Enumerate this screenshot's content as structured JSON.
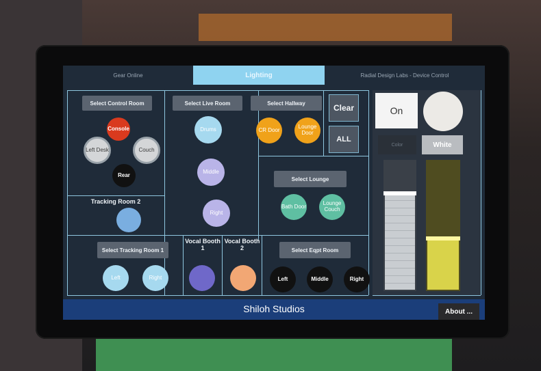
{
  "tabs": [
    {
      "label": "Gear Online"
    },
    {
      "label": "Lighting"
    },
    {
      "label": "Radial Design Labs - Device Control"
    }
  ],
  "control_room": {
    "select_label": "Select Control Room",
    "console": "Console",
    "left_desk": "Left Desk",
    "couch": "Couch",
    "rear": "Rear"
  },
  "live_room": {
    "select_label": "Select Live Room",
    "drums": "Drums",
    "middle": "Middle",
    "right": "Right"
  },
  "hallway": {
    "select_label": "Select Hallway",
    "cr_door": "CR Door",
    "lounge_door": "Lounge Door"
  },
  "quick": {
    "clear": "Clear",
    "all": "ALL"
  },
  "lounge": {
    "select_label": "Select Lounge",
    "bath_door": "Bath Door",
    "lounge_couch": "Lounge Couch"
  },
  "tracking_room_2": {
    "label": "Tracking Room 2"
  },
  "tracking_room_1": {
    "select_label": "Select Tracking Room 1",
    "left": "Left",
    "right": "Right"
  },
  "vocal_booth_1": {
    "label": "Vocal Booth 1"
  },
  "vocal_booth_2": {
    "label": "Vocal Booth 2"
  },
  "equipment_room": {
    "select_label": "Select Eqpt Room",
    "left": "Left",
    "middle": "Middle",
    "right": "Right"
  },
  "controls": {
    "on_label": "On",
    "color_label": "Color",
    "white_label": "White",
    "color_level": 0.75,
    "white_level": 0.4
  },
  "footer": {
    "title": "Shiloh Studios",
    "about": "About ..."
  },
  "colors": {
    "accent": "#8fd3f0",
    "console": "#d93a1e",
    "hall_orange": "#f0a21a",
    "teal": "#5fbfa2",
    "light_blue": "#a6d9ef",
    "lavender": "#b9b4e8",
    "blue": "#7aaee0",
    "purple": "#6f68c9",
    "peach": "#f2a774",
    "yellow_fader": "#d9d34a"
  }
}
